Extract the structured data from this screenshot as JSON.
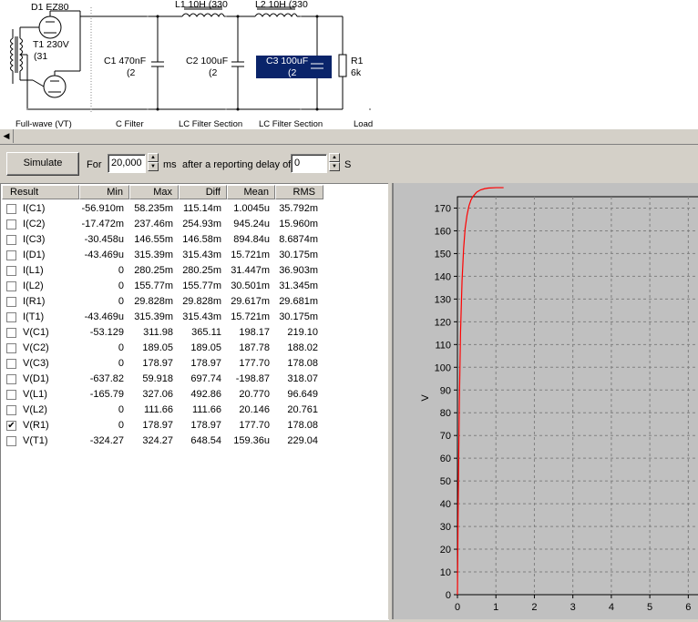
{
  "schematic": {
    "labels": {
      "d1": "D1 EZ80",
      "t1": "T1 230V",
      "t1b": "(31",
      "l1": "L1 10H (330",
      "l2": "L2 10H (330",
      "c1a": "C1 470nF",
      "c1b": "(2",
      "c2a": "C2 100uF",
      "c2b": "(2",
      "c3a": "C3 100uF",
      "c3b": "(2",
      "r1a": "R1",
      "r1b": "6k"
    },
    "sections": {
      "s1": "Full-wave (VT)",
      "s2": "C Filter",
      "s3": "LC Filter Section",
      "s4": "LC Filter Section",
      "s5": "Load"
    }
  },
  "toolbar": {
    "simulate": "Simulate",
    "for_label": "For",
    "for_value": "20,000",
    "ms_label": "ms",
    "delay_label": "after a reporting delay of",
    "delay_value": "0",
    "s_label": "S"
  },
  "table": {
    "headers": [
      "Result",
      "Min",
      "Max",
      "Diff",
      "Mean",
      "RMS"
    ],
    "rows": [
      {
        "name": "I(C1)",
        "min": "-56.910m",
        "max": "58.235m",
        "diff": "115.14m",
        "mean": "1.0045u",
        "rms": "35.792m",
        "checked": false
      },
      {
        "name": "I(C2)",
        "min": "-17.472m",
        "max": "237.46m",
        "diff": "254.93m",
        "mean": "945.24u",
        "rms": "15.960m",
        "checked": false
      },
      {
        "name": "I(C3)",
        "min": "-30.458u",
        "max": "146.55m",
        "diff": "146.58m",
        "mean": "894.84u",
        "rms": "8.6874m",
        "checked": false
      },
      {
        "name": "I(D1)",
        "min": "-43.469u",
        "max": "315.39m",
        "diff": "315.43m",
        "mean": "15.721m",
        "rms": "30.175m",
        "checked": false
      },
      {
        "name": "I(L1)",
        "min": "0",
        "max": "280.25m",
        "diff": "280.25m",
        "mean": "31.447m",
        "rms": "36.903m",
        "checked": false
      },
      {
        "name": "I(L2)",
        "min": "0",
        "max": "155.77m",
        "diff": "155.77m",
        "mean": "30.501m",
        "rms": "31.345m",
        "checked": false
      },
      {
        "name": "I(R1)",
        "min": "0",
        "max": "29.828m",
        "diff": "29.828m",
        "mean": "29.617m",
        "rms": "29.681m",
        "checked": false
      },
      {
        "name": "I(T1)",
        "min": "-43.469u",
        "max": "315.39m",
        "diff": "315.43m",
        "mean": "15.721m",
        "rms": "30.175m",
        "checked": false
      },
      {
        "name": "V(C1)",
        "min": "-53.129",
        "max": "311.98",
        "diff": "365.11",
        "mean": "198.17",
        "rms": "219.10",
        "checked": false
      },
      {
        "name": "V(C2)",
        "min": "0",
        "max": "189.05",
        "diff": "189.05",
        "mean": "187.78",
        "rms": "188.02",
        "checked": false
      },
      {
        "name": "V(C3)",
        "min": "0",
        "max": "178.97",
        "diff": "178.97",
        "mean": "177.70",
        "rms": "178.08",
        "checked": false
      },
      {
        "name": "V(D1)",
        "min": "-637.82",
        "max": "59.918",
        "diff": "697.74",
        "mean": "-198.87",
        "rms": "318.07",
        "checked": false
      },
      {
        "name": "V(L1)",
        "min": "-165.79",
        "max": "327.06",
        "diff": "492.86",
        "mean": "20.770",
        "rms": "96.649",
        "checked": false
      },
      {
        "name": "V(L2)",
        "min": "0",
        "max": "111.66",
        "diff": "111.66",
        "mean": "20.146",
        "rms": "20.761",
        "checked": false
      },
      {
        "name": "V(R1)",
        "min": "0",
        "max": "178.97",
        "diff": "178.97",
        "mean": "177.70",
        "rms": "178.08",
        "checked": true
      },
      {
        "name": "V(T1)",
        "min": "-324.27",
        "max": "324.27",
        "diff": "648.54",
        "mean": "159.36u",
        "rms": "229.04",
        "checked": false
      }
    ]
  },
  "chart_data": {
    "type": "line",
    "ylabel": "V",
    "xlabel": "",
    "xlim": [
      0,
      6
    ],
    "ylim": [
      0,
      175
    ],
    "xticks": [
      "0",
      "1",
      "2",
      "3",
      "4",
      "5",
      "6"
    ],
    "yticks": [
      "0",
      "10",
      "20",
      "30",
      "40",
      "50",
      "60",
      "70",
      "80",
      "90",
      "100",
      "110",
      "120",
      "130",
      "140",
      "150",
      "160",
      "170"
    ],
    "grid": true,
    "series": [
      {
        "color": "#ff0000",
        "x": [
          0,
          0.02,
          0.05,
          0.08,
          0.12,
          0.16,
          0.2,
          0.25,
          0.3,
          0.35,
          0.4,
          0.5,
          0.6,
          0.7,
          0.8,
          1.0,
          1.2
        ],
        "y": [
          0,
          40,
          85,
          115,
          138,
          152,
          161,
          167,
          171,
          173.5,
          175,
          177,
          178,
          178.5,
          178.8,
          178.97,
          178.97
        ]
      }
    ]
  }
}
